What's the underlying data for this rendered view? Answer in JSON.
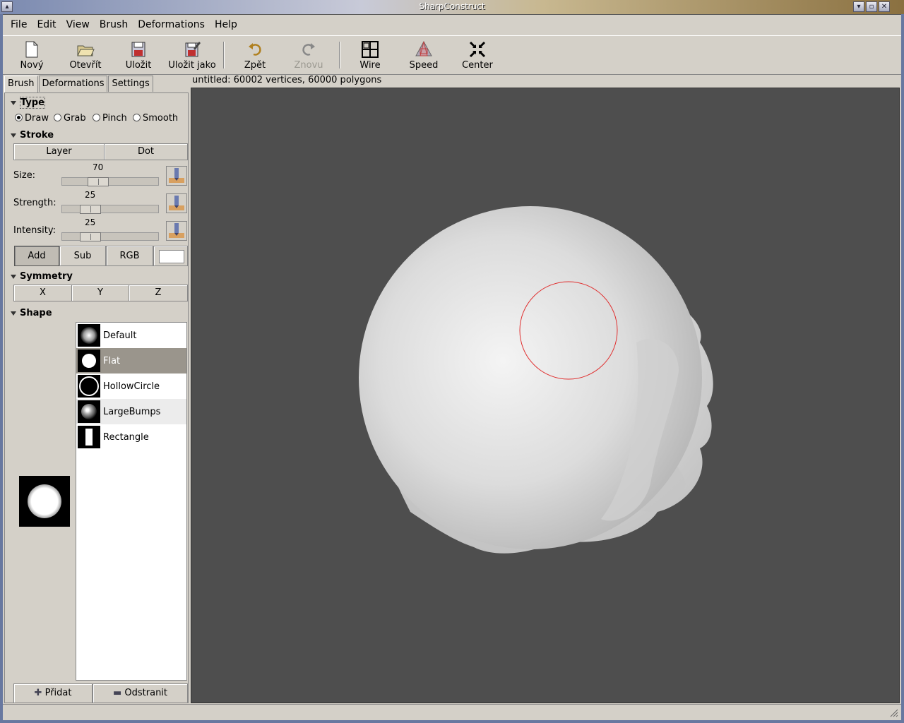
{
  "window": {
    "title": "SharpConstruct"
  },
  "menubar": {
    "items": [
      "File",
      "Edit",
      "View",
      "Brush",
      "Deformations",
      "Help"
    ]
  },
  "toolbar": {
    "new_label": "Nový",
    "open_label": "Otevřít",
    "save_label": "Uložit",
    "save_as_label": "Uložit jako",
    "undo_label": "Zpět",
    "redo_label": "Znovu",
    "wire_label": "Wire",
    "speed_label": "Speed",
    "center_label": "Center"
  },
  "tabs": [
    "Brush",
    "Deformations",
    "Settings"
  ],
  "type_section": {
    "title": "Type",
    "options": [
      "Draw",
      "Grab",
      "Pinch",
      "Smooth"
    ],
    "selected": "Draw"
  },
  "stroke_section": {
    "title": "Stroke",
    "layer_label": "Layer",
    "dot_label": "Dot",
    "size_label": "Size:",
    "size_value": "70",
    "strength_label": "Strength:",
    "strength_value": "25",
    "intensity_label": "Intensity:",
    "intensity_value": "25",
    "add_label": "Add",
    "sub_label": "Sub",
    "rgb_label": "RGB",
    "color": "#ffffff"
  },
  "symmetry_section": {
    "title": "Symmetry",
    "x_label": "X",
    "y_label": "Y",
    "z_label": "Z"
  },
  "shape_section": {
    "title": "Shape",
    "items": [
      "Default",
      "Flat",
      "HollowCircle",
      "LargeBumps",
      "Rectangle"
    ],
    "selected": "Flat",
    "add_label": "Přidat",
    "remove_label": "Odstranit"
  },
  "viewport": {
    "info": "untitled: 60002 vertices, 60000 polygons",
    "background": "#4e4e4e",
    "brush_cursor_color": "#e03030"
  }
}
